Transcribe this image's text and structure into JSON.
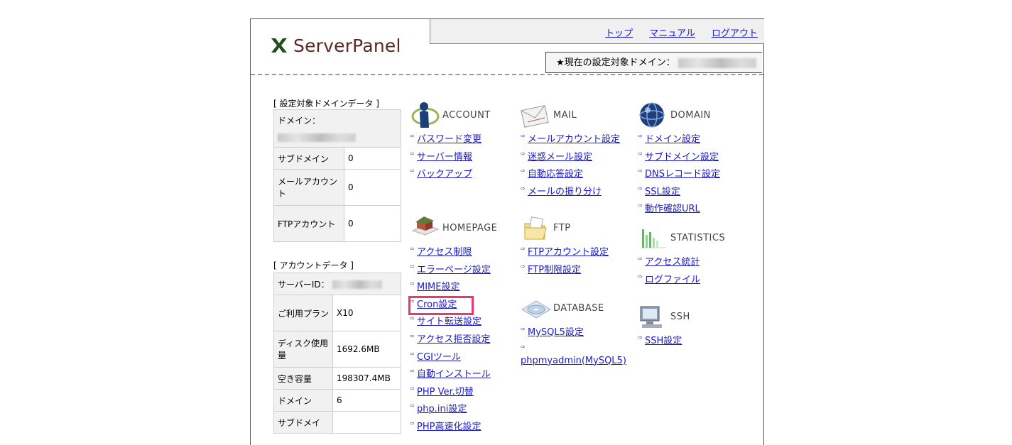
{
  "header": {
    "logo_text": "ServerPanel",
    "nav": [
      "トップ",
      "マニュアル",
      "ログアウト"
    ],
    "domain_label": "★現在の設定対象ドメイン："
  },
  "domain_data": {
    "title": "[ 設定対象ドメインデータ ]",
    "domain_label": "ドメイン：",
    "rows": [
      {
        "label": "サブドメイン",
        "value": "0"
      },
      {
        "label": "メールアカウント",
        "value": "0"
      },
      {
        "label": "FTPアカウント",
        "value": "0"
      }
    ]
  },
  "account_data": {
    "title": "[ アカウントデータ ]",
    "server_id_label": "サーバーID：",
    "rows": [
      {
        "label": "ご利用プラン",
        "value": "X10"
      },
      {
        "label": "ディスク使用量",
        "value": "1692.6MB"
      },
      {
        "label": "空き容量",
        "value": "198307.4MB"
      },
      {
        "label": "ドメイン",
        "value": "6"
      },
      {
        "label": "サブドメイ",
        "value": ""
      }
    ]
  },
  "menus": {
    "account": {
      "label": "ACCOUNT",
      "links": [
        "パスワード変更",
        "サーバー情報",
        "バックアップ"
      ]
    },
    "mail": {
      "label": "MAIL",
      "links": [
        "メールアカウント設定",
        "迷惑メール設定",
        "自動応答設定",
        "メールの振り分け"
      ]
    },
    "domain": {
      "label": "DOMAIN",
      "links": [
        "ドメイン設定",
        "サブドメイン設定",
        "DNSレコード設定",
        "SSL設定",
        "動作確認URL"
      ]
    },
    "homepage": {
      "label": "HOMEPAGE",
      "links": [
        "アクセス制限",
        "エラーページ設定",
        "MIME設定",
        "Cron設定",
        "サイト転送設定",
        "アクセス拒否設定",
        "CGIツール",
        "自動インストール",
        "PHP Ver.切替",
        "php.ini設定",
        "PHP高速化設定"
      ]
    },
    "ftp": {
      "label": "FTP",
      "links": [
        "FTPアカウント設定",
        "FTP制限設定"
      ]
    },
    "statistics": {
      "label": "STATISTICS",
      "links": [
        "アクセス統計",
        "ログファイル"
      ]
    },
    "database": {
      "label": "DATABASE",
      "links": [
        "MySQL5設定",
        "phpmyadmin(MySQL5)"
      ]
    },
    "ssh": {
      "label": "SSH",
      "links": [
        "SSH設定"
      ]
    }
  },
  "colors": {
    "highlight": "#e8386f",
    "link": "#1a1ac8",
    "logo": "#5a2a22"
  }
}
